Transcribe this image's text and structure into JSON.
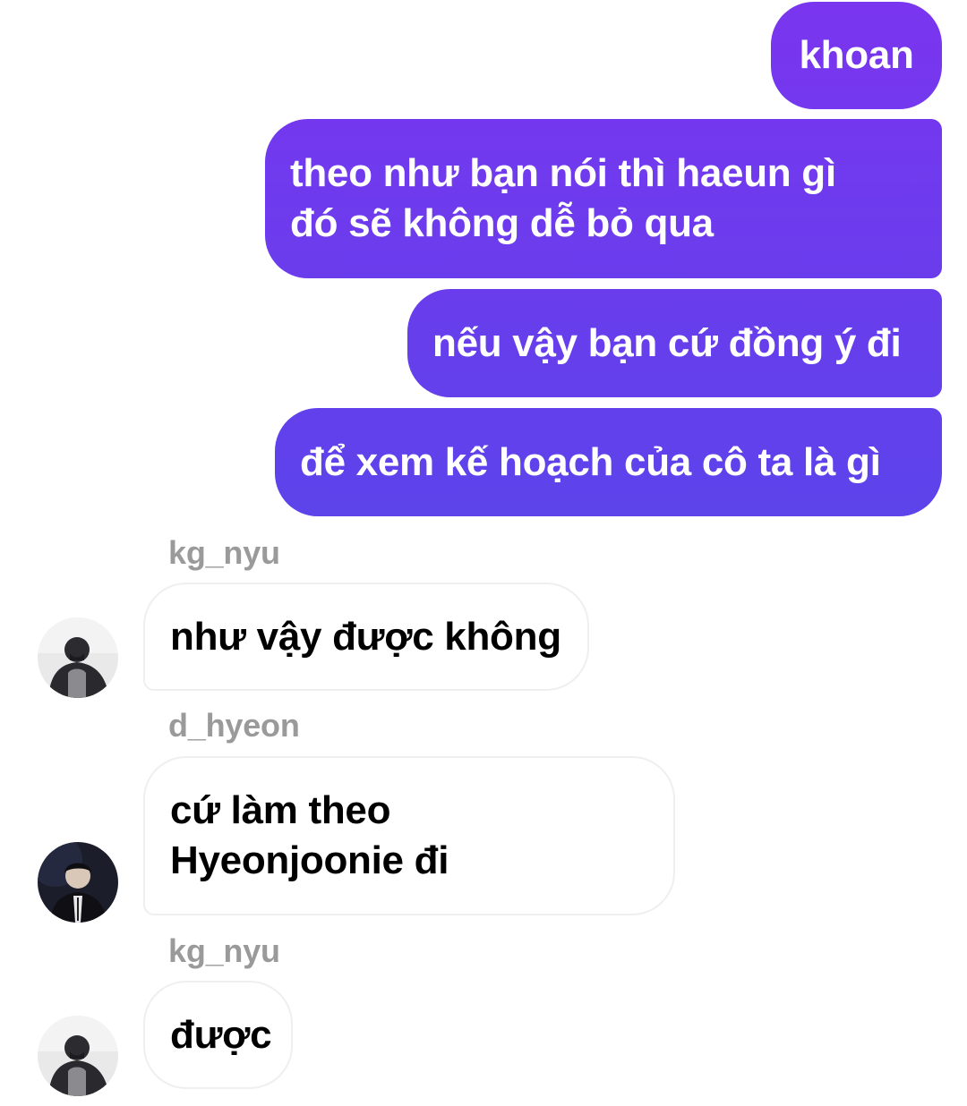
{
  "conversation": {
    "outgoing": [
      {
        "text": "khoan"
      },
      {
        "text": "theo như bạn nói thì haeun gì đó sẽ không dễ bỏ qua"
      },
      {
        "text": "nếu vậy bạn cứ đồng ý đi"
      },
      {
        "text": "để xem kế hoạch của cô ta là gì"
      }
    ],
    "incoming": [
      {
        "username": "kg_nyu",
        "text": "như vậy được không",
        "avatar_icon": "user-avatar-icon"
      },
      {
        "username": "d_hyeon",
        "text": "cứ làm theo Hyeonjoonie đi",
        "avatar_icon": "user-avatar-icon"
      },
      {
        "username": "kg_nyu",
        "text": "được",
        "avatar_icon": "user-avatar-icon"
      }
    ]
  },
  "colors": {
    "outgoing_gradient_top": "#7a35ef",
    "outgoing_gradient_bottom": "#4654e8",
    "incoming_border": "#efefef",
    "username": "#9a9a9a"
  }
}
